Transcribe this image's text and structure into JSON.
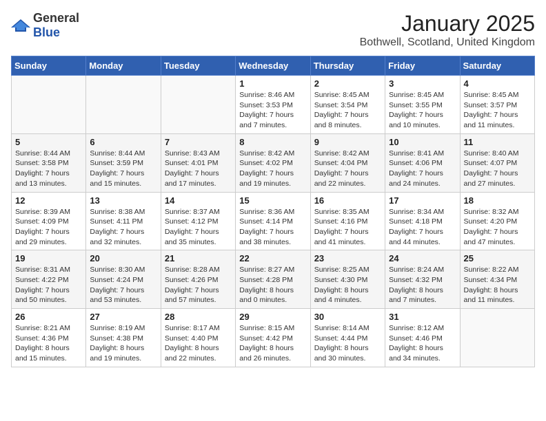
{
  "header": {
    "logo": {
      "general": "General",
      "blue": "Blue"
    },
    "title": "January 2025",
    "location": "Bothwell, Scotland, United Kingdom"
  },
  "weekdays": [
    "Sunday",
    "Monday",
    "Tuesday",
    "Wednesday",
    "Thursday",
    "Friday",
    "Saturday"
  ],
  "weeks": [
    [
      {
        "day": "",
        "info": ""
      },
      {
        "day": "",
        "info": ""
      },
      {
        "day": "",
        "info": ""
      },
      {
        "day": "1",
        "info": "Sunrise: 8:46 AM\nSunset: 3:53 PM\nDaylight: 7 hours\nand 7 minutes."
      },
      {
        "day": "2",
        "info": "Sunrise: 8:45 AM\nSunset: 3:54 PM\nDaylight: 7 hours\nand 8 minutes."
      },
      {
        "day": "3",
        "info": "Sunrise: 8:45 AM\nSunset: 3:55 PM\nDaylight: 7 hours\nand 10 minutes."
      },
      {
        "day": "4",
        "info": "Sunrise: 8:45 AM\nSunset: 3:57 PM\nDaylight: 7 hours\nand 11 minutes."
      }
    ],
    [
      {
        "day": "5",
        "info": "Sunrise: 8:44 AM\nSunset: 3:58 PM\nDaylight: 7 hours\nand 13 minutes."
      },
      {
        "day": "6",
        "info": "Sunrise: 8:44 AM\nSunset: 3:59 PM\nDaylight: 7 hours\nand 15 minutes."
      },
      {
        "day": "7",
        "info": "Sunrise: 8:43 AM\nSunset: 4:01 PM\nDaylight: 7 hours\nand 17 minutes."
      },
      {
        "day": "8",
        "info": "Sunrise: 8:42 AM\nSunset: 4:02 PM\nDaylight: 7 hours\nand 19 minutes."
      },
      {
        "day": "9",
        "info": "Sunrise: 8:42 AM\nSunset: 4:04 PM\nDaylight: 7 hours\nand 22 minutes."
      },
      {
        "day": "10",
        "info": "Sunrise: 8:41 AM\nSunset: 4:06 PM\nDaylight: 7 hours\nand 24 minutes."
      },
      {
        "day": "11",
        "info": "Sunrise: 8:40 AM\nSunset: 4:07 PM\nDaylight: 7 hours\nand 27 minutes."
      }
    ],
    [
      {
        "day": "12",
        "info": "Sunrise: 8:39 AM\nSunset: 4:09 PM\nDaylight: 7 hours\nand 29 minutes."
      },
      {
        "day": "13",
        "info": "Sunrise: 8:38 AM\nSunset: 4:11 PM\nDaylight: 7 hours\nand 32 minutes."
      },
      {
        "day": "14",
        "info": "Sunrise: 8:37 AM\nSunset: 4:12 PM\nDaylight: 7 hours\nand 35 minutes."
      },
      {
        "day": "15",
        "info": "Sunrise: 8:36 AM\nSunset: 4:14 PM\nDaylight: 7 hours\nand 38 minutes."
      },
      {
        "day": "16",
        "info": "Sunrise: 8:35 AM\nSunset: 4:16 PM\nDaylight: 7 hours\nand 41 minutes."
      },
      {
        "day": "17",
        "info": "Sunrise: 8:34 AM\nSunset: 4:18 PM\nDaylight: 7 hours\nand 44 minutes."
      },
      {
        "day": "18",
        "info": "Sunrise: 8:32 AM\nSunset: 4:20 PM\nDaylight: 7 hours\nand 47 minutes."
      }
    ],
    [
      {
        "day": "19",
        "info": "Sunrise: 8:31 AM\nSunset: 4:22 PM\nDaylight: 7 hours\nand 50 minutes."
      },
      {
        "day": "20",
        "info": "Sunrise: 8:30 AM\nSunset: 4:24 PM\nDaylight: 7 hours\nand 53 minutes."
      },
      {
        "day": "21",
        "info": "Sunrise: 8:28 AM\nSunset: 4:26 PM\nDaylight: 7 hours\nand 57 minutes."
      },
      {
        "day": "22",
        "info": "Sunrise: 8:27 AM\nSunset: 4:28 PM\nDaylight: 8 hours\nand 0 minutes."
      },
      {
        "day": "23",
        "info": "Sunrise: 8:25 AM\nSunset: 4:30 PM\nDaylight: 8 hours\nand 4 minutes."
      },
      {
        "day": "24",
        "info": "Sunrise: 8:24 AM\nSunset: 4:32 PM\nDaylight: 8 hours\nand 7 minutes."
      },
      {
        "day": "25",
        "info": "Sunrise: 8:22 AM\nSunset: 4:34 PM\nDaylight: 8 hours\nand 11 minutes."
      }
    ],
    [
      {
        "day": "26",
        "info": "Sunrise: 8:21 AM\nSunset: 4:36 PM\nDaylight: 8 hours\nand 15 minutes."
      },
      {
        "day": "27",
        "info": "Sunrise: 8:19 AM\nSunset: 4:38 PM\nDaylight: 8 hours\nand 19 minutes."
      },
      {
        "day": "28",
        "info": "Sunrise: 8:17 AM\nSunset: 4:40 PM\nDaylight: 8 hours\nand 22 minutes."
      },
      {
        "day": "29",
        "info": "Sunrise: 8:15 AM\nSunset: 4:42 PM\nDaylight: 8 hours\nand 26 minutes."
      },
      {
        "day": "30",
        "info": "Sunrise: 8:14 AM\nSunset: 4:44 PM\nDaylight: 8 hours\nand 30 minutes."
      },
      {
        "day": "31",
        "info": "Sunrise: 8:12 AM\nSunset: 4:46 PM\nDaylight: 8 hours\nand 34 minutes."
      },
      {
        "day": "",
        "info": ""
      }
    ]
  ]
}
